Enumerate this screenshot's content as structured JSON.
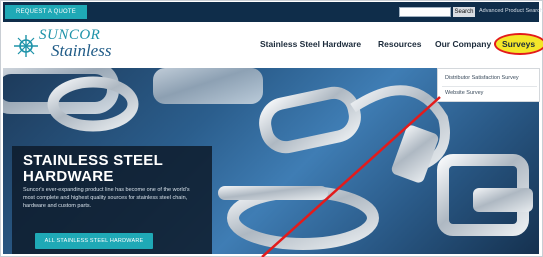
{
  "topbar": {
    "quote_label": "REQUEST A QUOTE",
    "search_value": "",
    "search_button": "Search",
    "advanced_search": "Advanced Product Search"
  },
  "logo": {
    "line1": "SUNCOR",
    "line2": "Stainless"
  },
  "nav": {
    "items": [
      "Stainless Steel Hardware",
      "Resources",
      "Our Company",
      "Surveys"
    ]
  },
  "dropdown": {
    "items": [
      "Distributor Satisfaction Survey",
      "Website Survey"
    ]
  },
  "hero": {
    "title": "STAINLESS STEEL HARDWARE",
    "description": "Suncor's ever-expanding product line has become one of the world's most complete and highest quality sources for stainless steel chain, hardware and custom parts.",
    "button": "ALL STAINLESS STEEL HARDWARE"
  },
  "colors": {
    "topbar_bg": "#0f2d4a",
    "accent_teal": "#1fa9b6",
    "highlight_yellow": "#f4e629",
    "annotation_red": "#e31b1b"
  }
}
